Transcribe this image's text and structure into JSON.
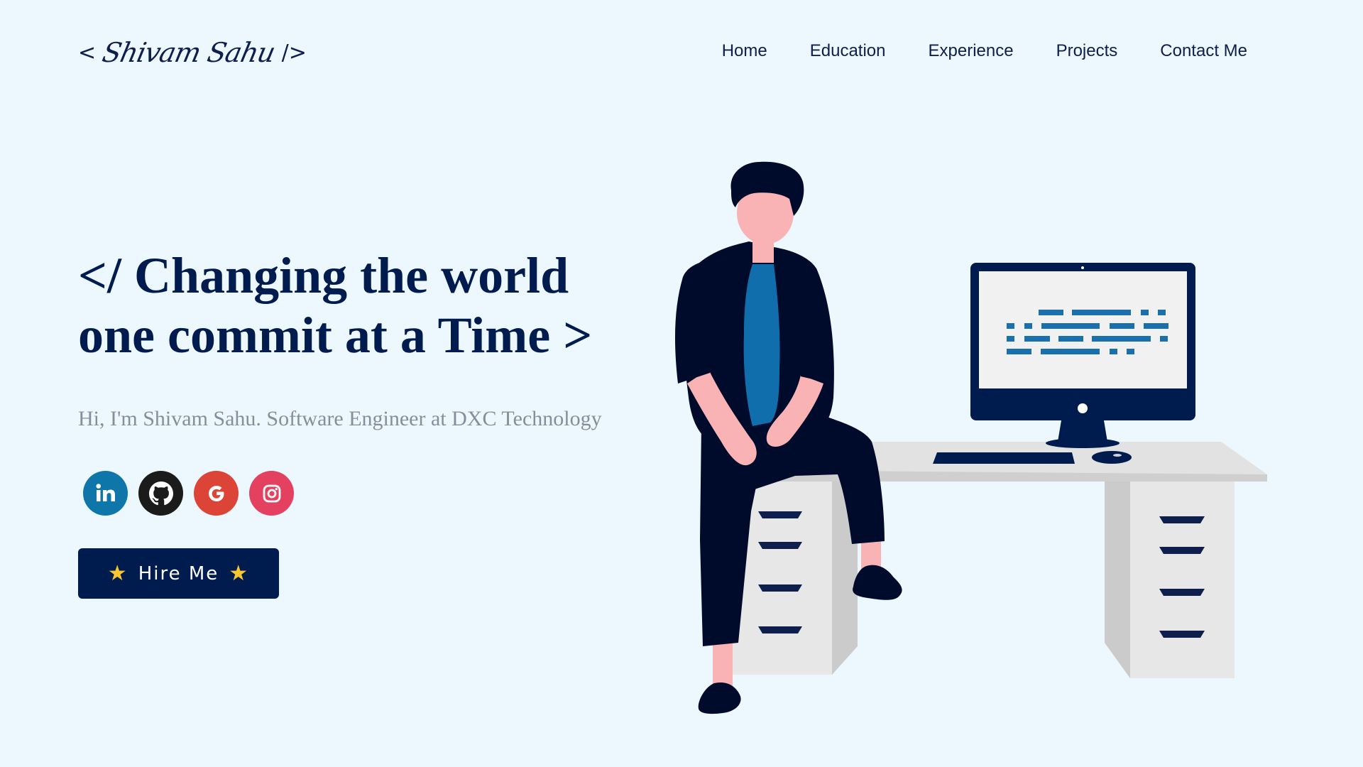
{
  "header": {
    "logo": {
      "open_bracket": "<",
      "signature": "Shivam Sahu",
      "close_bracket": "/>"
    },
    "nav": [
      "Home",
      "Education",
      "Experience",
      "Projects",
      "Contact Me"
    ]
  },
  "hero": {
    "headline_line1": "</ Changing the world",
    "headline_line2": "one commit at a Time >",
    "subtitle": "Hi, I'm Shivam Sahu. Software Engineer at DXC Technology",
    "socials": [
      {
        "icon": "linkedin-icon",
        "color": "#0e76a8"
      },
      {
        "icon": "github-icon",
        "color": "#1b1b1b"
      },
      {
        "icon": "google-icon",
        "color": "#db4437"
      },
      {
        "icon": "instagram-icon",
        "color": "#e4405f"
      }
    ],
    "hire_button": {
      "label": "Hire Me",
      "star_left": "★",
      "star_right": "★"
    }
  },
  "illustration": {
    "name": "developer-at-desk-illustration"
  },
  "colors": {
    "background": "#edf7fe",
    "primary": "#001b4d",
    "subtitle": "#868e9c",
    "accent_blue": "#1a6fad",
    "star": "#fbc531"
  },
  "scrollbar": {
    "up_arrow": "▲",
    "down_arrow": "▼"
  }
}
